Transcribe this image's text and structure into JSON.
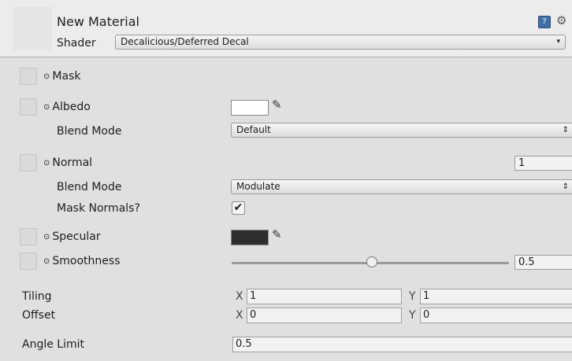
{
  "header": {
    "title": "New Material",
    "shader_label": "Shader",
    "shader_value": "Decalicious/Deferred Decal",
    "help_icon": "help-book-icon",
    "settings_icon": "gear-icon"
  },
  "properties": {
    "mask": {
      "label": "Mask"
    },
    "albedo": {
      "label": "Albedo",
      "color": "#ffffff",
      "blend_label": "Blend Mode",
      "blend_value": "Default"
    },
    "normal": {
      "label": "Normal",
      "value": "1",
      "blend_label": "Blend Mode",
      "blend_value": "Modulate",
      "mask_normals_label": "Mask Normals?",
      "mask_normals_checked": true
    },
    "specular": {
      "label": "Specular",
      "color": "#2d2d2d"
    },
    "smoothness": {
      "label": "Smoothness",
      "value": "0.5",
      "slider_fraction": 0.5
    }
  },
  "tiling": {
    "label": "Tiling",
    "x_label": "X",
    "x": "1",
    "y_label": "Y",
    "y": "1"
  },
  "offset": {
    "label": "Offset",
    "x_label": "X",
    "x": "0",
    "y_label": "Y",
    "y": "0"
  },
  "angle_limit": {
    "label": "Angle Limit",
    "value": "0.5"
  },
  "glyphs": {
    "dot": "⊙",
    "check": "✔",
    "dropdown_arrow": "▾",
    "updown": "⇕",
    "eyedropper": "✎"
  }
}
